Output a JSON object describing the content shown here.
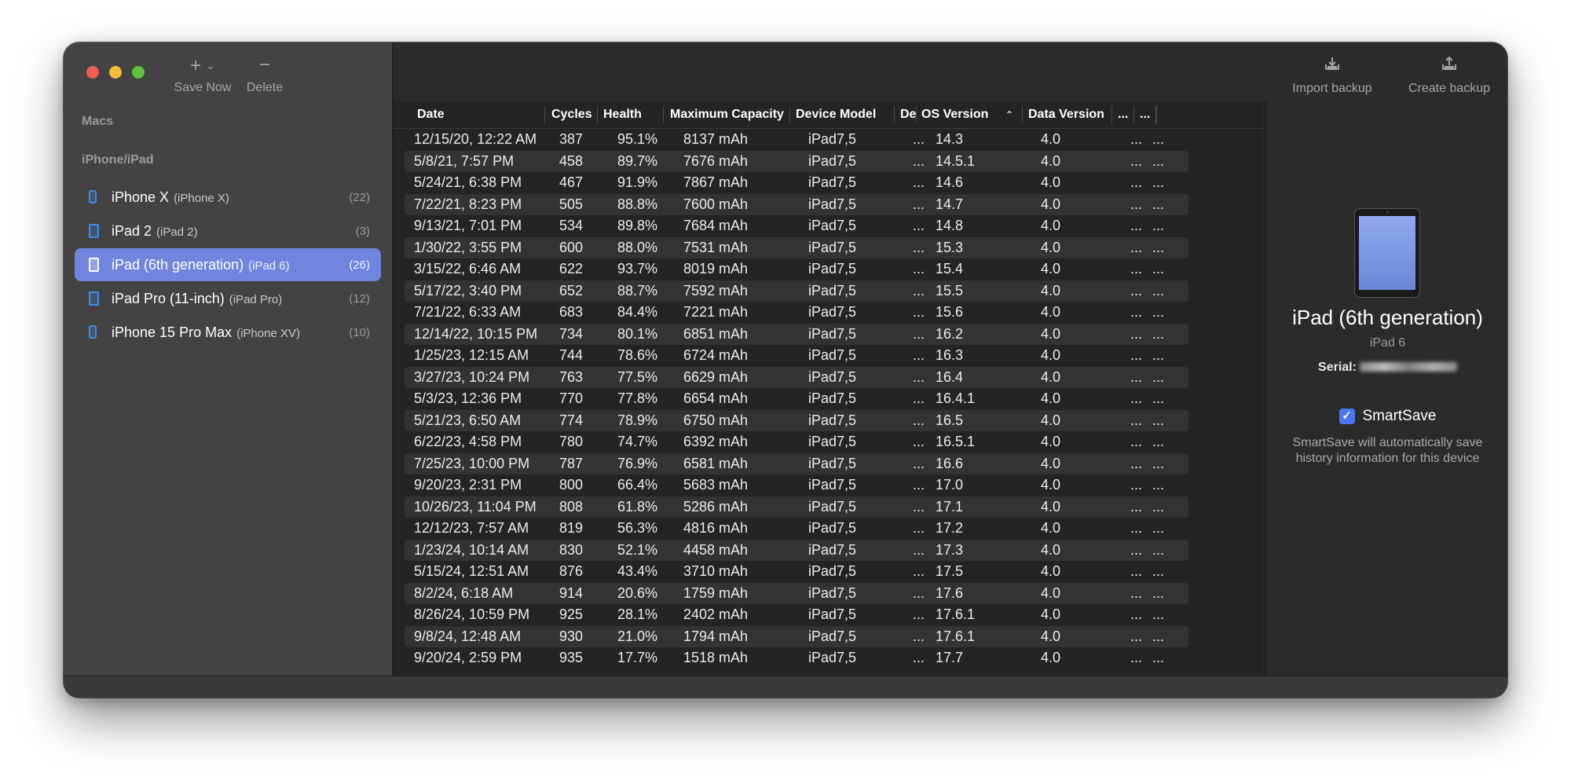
{
  "toolbar": {
    "save_now": "Save Now",
    "delete": "Delete",
    "import_backup": "Import backup",
    "create_backup": "Create backup"
  },
  "sidebar": {
    "section_macs": "Macs",
    "section_ios": "iPhone/iPad",
    "devices": [
      {
        "name": "iPhone X",
        "model": "(iPhone X)",
        "count": "(22)",
        "kind": "phone",
        "selected": false
      },
      {
        "name": "iPad 2",
        "model": "(iPad 2)",
        "count": "(3)",
        "kind": "tablet",
        "selected": false
      },
      {
        "name": "iPad (6th generation)",
        "model": "(iPad 6)",
        "count": "(26)",
        "kind": "tablet",
        "selected": true
      },
      {
        "name": "iPad Pro (11-inch)",
        "model": "(iPad Pro)",
        "count": "(12)",
        "kind": "tablet",
        "selected": false
      },
      {
        "name": "iPhone 15 Pro Max",
        "model": "(iPhone XV)",
        "count": "(10)",
        "kind": "phone",
        "selected": false
      }
    ]
  },
  "table": {
    "headers": {
      "date": "Date",
      "cycles": "Cycles",
      "health": "Health",
      "capacity": "Maximum Capacity",
      "model": "Device Model",
      "de": "De",
      "os": "OS Version",
      "data_version": "Data Version",
      "extra1": "...",
      "extra2": "..."
    },
    "sorted_column": "OS Version",
    "rows": [
      [
        "12/15/20, 12:22 AM",
        "387",
        "95.1%",
        "8137 mAh",
        "iPad7,5",
        "...",
        "14.3",
        "4.0",
        "...",
        "..."
      ],
      [
        "5/8/21, 7:57 PM",
        "458",
        "89.7%",
        "7676 mAh",
        "iPad7,5",
        "...",
        "14.5.1",
        "4.0",
        "...",
        "..."
      ],
      [
        "5/24/21, 6:38 PM",
        "467",
        "91.9%",
        "7867 mAh",
        "iPad7,5",
        "...",
        "14.6",
        "4.0",
        "...",
        "..."
      ],
      [
        "7/22/21, 8:23 PM",
        "505",
        "88.8%",
        "7600 mAh",
        "iPad7,5",
        "...",
        "14.7",
        "4.0",
        "...",
        "..."
      ],
      [
        "9/13/21, 7:01 PM",
        "534",
        "89.8%",
        "7684 mAh",
        "iPad7,5",
        "...",
        "14.8",
        "4.0",
        "...",
        "..."
      ],
      [
        "1/30/22, 3:55 PM",
        "600",
        "88.0%",
        "7531 mAh",
        "iPad7,5",
        "...",
        "15.3",
        "4.0",
        "...",
        "..."
      ],
      [
        "3/15/22, 6:46 AM",
        "622",
        "93.7%",
        "8019 mAh",
        "iPad7,5",
        "...",
        "15.4",
        "4.0",
        "...",
        "..."
      ],
      [
        "5/17/22, 3:40 PM",
        "652",
        "88.7%",
        "7592 mAh",
        "iPad7,5",
        "...",
        "15.5",
        "4.0",
        "...",
        "..."
      ],
      [
        "7/21/22, 6:33 AM",
        "683",
        "84.4%",
        "7221 mAh",
        "iPad7,5",
        "...",
        "15.6",
        "4.0",
        "...",
        "..."
      ],
      [
        "12/14/22, 10:15 PM",
        "734",
        "80.1%",
        "6851 mAh",
        "iPad7,5",
        "...",
        "16.2",
        "4.0",
        "...",
        "..."
      ],
      [
        "1/25/23, 12:15 AM",
        "744",
        "78.6%",
        "6724 mAh",
        "iPad7,5",
        "...",
        "16.3",
        "4.0",
        "...",
        "..."
      ],
      [
        "3/27/23, 10:24 PM",
        "763",
        "77.5%",
        "6629 mAh",
        "iPad7,5",
        "...",
        "16.4",
        "4.0",
        "...",
        "..."
      ],
      [
        "5/3/23, 12:36 PM",
        "770",
        "77.8%",
        "6654 mAh",
        "iPad7,5",
        "...",
        "16.4.1",
        "4.0",
        "...",
        "..."
      ],
      [
        "5/21/23, 6:50 AM",
        "774",
        "78.9%",
        "6750 mAh",
        "iPad7,5",
        "...",
        "16.5",
        "4.0",
        "...",
        "..."
      ],
      [
        "6/22/23, 4:58 PM",
        "780",
        "74.7%",
        "6392 mAh",
        "iPad7,5",
        "...",
        "16.5.1",
        "4.0",
        "...",
        "..."
      ],
      [
        "7/25/23, 10:00 PM",
        "787",
        "76.9%",
        "6581 mAh",
        "iPad7,5",
        "...",
        "16.6",
        "4.0",
        "...",
        "..."
      ],
      [
        "9/20/23, 2:31 PM",
        "800",
        "66.4%",
        "5683 mAh",
        "iPad7,5",
        "...",
        "17.0",
        "4.0",
        "...",
        "..."
      ],
      [
        "10/26/23, 11:04 PM",
        "808",
        "61.8%",
        "5286 mAh",
        "iPad7,5",
        "...",
        "17.1",
        "4.0",
        "...",
        "..."
      ],
      [
        "12/12/23, 7:57 AM",
        "819",
        "56.3%",
        "4816 mAh",
        "iPad7,5",
        "...",
        "17.2",
        "4.0",
        "...",
        "..."
      ],
      [
        "1/23/24, 10:14 AM",
        "830",
        "52.1%",
        "4458 mAh",
        "iPad7,5",
        "...",
        "17.3",
        "4.0",
        "...",
        "..."
      ],
      [
        "5/15/24, 12:51 AM",
        "876",
        "43.4%",
        "3710 mAh",
        "iPad7,5",
        "...",
        "17.5",
        "4.0",
        "...",
        "..."
      ],
      [
        "8/2/24, 6:18 AM",
        "914",
        "20.6%",
        "1759 mAh",
        "iPad7,5",
        "...",
        "17.6",
        "4.0",
        "...",
        "..."
      ],
      [
        "8/26/24, 10:59 PM",
        "925",
        "28.1%",
        "2402 mAh",
        "iPad7,5",
        "...",
        "17.6.1",
        "4.0",
        "...",
        "..."
      ],
      [
        "9/8/24, 12:48 AM",
        "930",
        "21.0%",
        "1794 mAh",
        "iPad7,5",
        "...",
        "17.6.1",
        "4.0",
        "...",
        "..."
      ],
      [
        "9/20/24, 2:59 PM",
        "935",
        "17.7%",
        "1518 mAh",
        "iPad7,5",
        "...",
        "17.7",
        "4.0",
        "...",
        "..."
      ]
    ]
  },
  "detail": {
    "device_name": "iPad (6th generation)",
    "device_model": "iPad 6",
    "serial_label": "Serial:",
    "smartsave_label": "SmartSave",
    "smartsave_checked": true,
    "smartsave_description": "SmartSave will automatically save history information for this device"
  },
  "colors": {
    "selection": "#7185de",
    "device_icon": "#3d8ef0",
    "checkbox": "#4a76f0"
  }
}
